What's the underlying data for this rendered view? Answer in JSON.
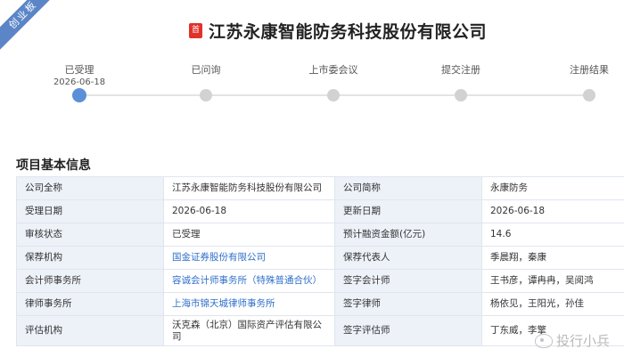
{
  "ribbon": "创业板",
  "header": {
    "badge": "首",
    "company_name": "江苏永康智能防务科技股份有限公司"
  },
  "progress": {
    "steps": [
      {
        "label": "已受理",
        "date": "2026-06-18",
        "active": true
      },
      {
        "label": "已问询",
        "date": "",
        "active": false
      },
      {
        "label": "上市委会议",
        "date": "",
        "active": false
      },
      {
        "label": "提交注册",
        "date": "",
        "active": false
      },
      {
        "label": "注册结果",
        "date": "",
        "active": false
      }
    ]
  },
  "section": {
    "title": "项目基本信息"
  },
  "info": {
    "rows": [
      [
        {
          "label": "公司全称",
          "value": "江苏永康智能防务科技股份有限公司"
        },
        {
          "label": "公司简称",
          "value": "永康防务"
        }
      ],
      [
        {
          "label": "受理日期",
          "value": "2026-06-18"
        },
        {
          "label": "更新日期",
          "value": "2026-06-18"
        }
      ],
      [
        {
          "label": "审核状态",
          "value": "已受理"
        },
        {
          "label": "预计融资金额(亿元)",
          "value": "14.6"
        }
      ],
      [
        {
          "label": "保荐机构",
          "value": "国金证券股份有限公司",
          "link": true
        },
        {
          "label": "保荐代表人",
          "value": "季晨翔，秦康"
        }
      ],
      [
        {
          "label": "会计师事务所",
          "value": "容诚会计师事务所（特殊普通合伙）",
          "link": true
        },
        {
          "label": "签字会计师",
          "value": "王书彦，谭冉冉，吴阅鸿"
        }
      ],
      [
        {
          "label": "律师事务所",
          "value": "上海市锦天城律师事务所",
          "link": true
        },
        {
          "label": "签字律师",
          "value": "杨依见，王阳光，孙佳"
        }
      ],
      [
        {
          "label": "评估机构",
          "value": "沃克森（北京）国际资产评估有限公司"
        },
        {
          "label": "签字评估师",
          "value": "丁东威，李擎"
        }
      ]
    ]
  },
  "watermark": "投行小兵"
}
